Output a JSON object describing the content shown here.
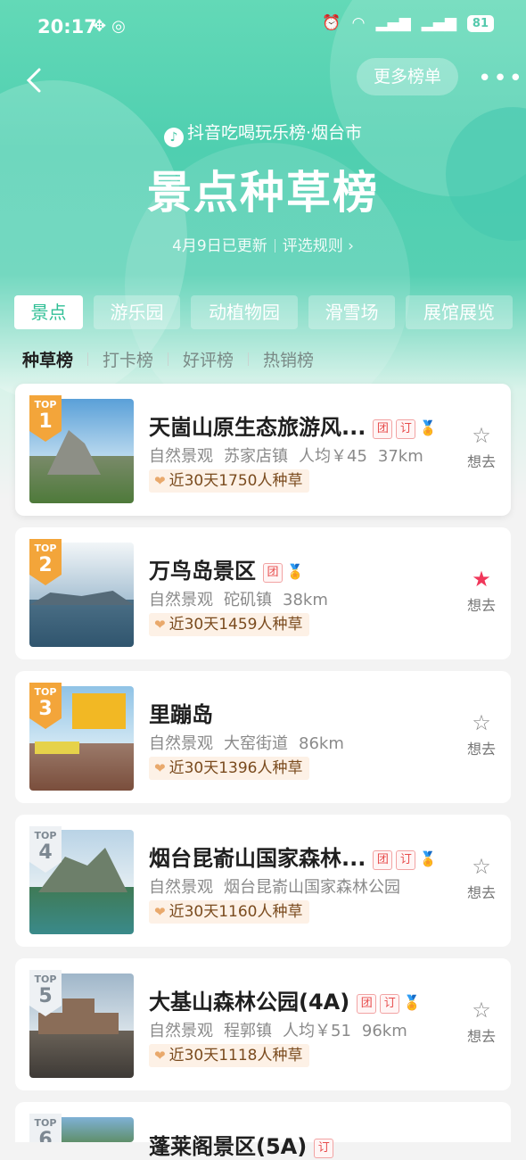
{
  "status": {
    "time": "20:17",
    "battery": "81"
  },
  "header": {
    "more_label": "更多榜单",
    "brand": "抖音吃喝玩乐榜·烟台市",
    "title": "景点种草榜",
    "updated": "4月9日已更新",
    "rules": "评选规则"
  },
  "categories": [
    {
      "label": "景点",
      "active": true
    },
    {
      "label": "游乐园",
      "active": false
    },
    {
      "label": "动植物园",
      "active": false
    },
    {
      "label": "滑雪场",
      "active": false
    },
    {
      "label": "展馆展览",
      "active": false
    }
  ],
  "subtabs": [
    {
      "label": "种草榜",
      "active": true
    },
    {
      "label": "打卡榜",
      "active": false
    },
    {
      "label": "好评榜",
      "active": false
    },
    {
      "label": "热销榜",
      "active": false
    }
  ],
  "items": [
    {
      "rank": "1",
      "top": "TOP",
      "name": "天崮山原生态旅游风...",
      "type": "自然景观",
      "area": "苏家店镇",
      "price": "人均￥45",
      "distance": "37km",
      "pop": "近30天1750人种草",
      "tuan": "团",
      "ding": "订",
      "want": "想去",
      "wanted": false
    },
    {
      "rank": "2",
      "top": "TOP",
      "name": "万鸟岛景区",
      "type": "自然景观",
      "area": "砣矶镇",
      "price": "",
      "distance": "38km",
      "pop": "近30天1459人种草",
      "tuan": "团",
      "ding": "",
      "want": "想去",
      "wanted": true
    },
    {
      "rank": "3",
      "top": "TOP",
      "name": "里蹦岛",
      "type": "自然景观",
      "area": "大窑街道",
      "price": "",
      "distance": "86km",
      "pop": "近30天1396人种草",
      "tuan": "",
      "ding": "",
      "want": "想去",
      "wanted": false
    },
    {
      "rank": "4",
      "top": "TOP",
      "name": "烟台昆嵛山国家森林...",
      "type": "自然景观",
      "area": "烟台昆嵛山国家森林公园",
      "price": "",
      "distance": "",
      "pop": "近30天1160人种草",
      "tuan": "团",
      "ding": "订",
      "want": "想去",
      "wanted": false
    },
    {
      "rank": "5",
      "top": "TOP",
      "name": "大基山森林公园(4A)",
      "type": "自然景观",
      "area": "程郭镇",
      "price": "人均￥51",
      "distance": "96km",
      "pop": "近30天1118人种草",
      "tuan": "团",
      "ding": "订",
      "want": "想去",
      "wanted": false
    },
    {
      "rank": "6",
      "top": "TOP",
      "name": "蓬莱阁景区(5A)",
      "type": "",
      "area": "",
      "price": "",
      "distance": "",
      "pop": "",
      "tuan": "",
      "ding": "订",
      "want": "",
      "wanted": false
    }
  ],
  "colors": {
    "accent": "#2fbf95",
    "hero": "#4fcfb0",
    "want_on": "#f0375a",
    "rank_gold": "#f3a53a",
    "rank_silver": "#b9c3cc"
  }
}
